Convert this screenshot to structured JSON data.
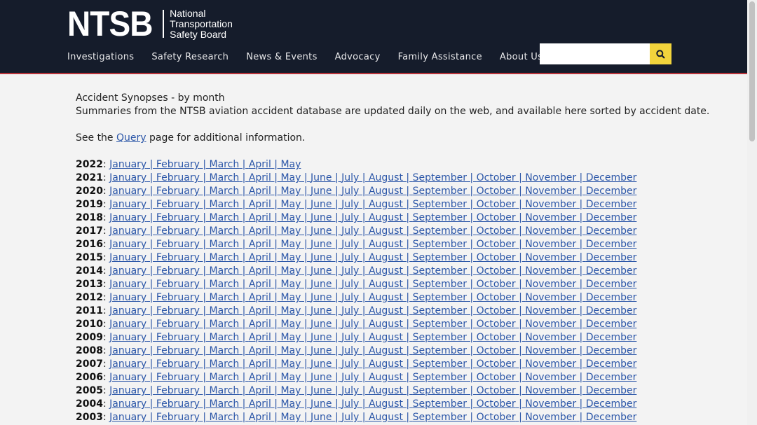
{
  "header": {
    "logo_mark": "NTSB",
    "logo_lines": [
      "National",
      "Transportation",
      "Safety Board"
    ],
    "nav": [
      "Investigations",
      "Safety Research",
      "News & Events",
      "Advocacy",
      "Family Assistance",
      "About Us"
    ],
    "search_placeholder": "",
    "search_icon": "search-icon"
  },
  "content": {
    "title": "Accident Synopses - by month",
    "description": "Summaries from the NTSB aviation accident database are updated daily on the web, and available here sorted by accident date.",
    "see_prefix": "See the ",
    "query_link": "Query",
    "see_suffix": " page for additional information.",
    "months": [
      "January",
      "February",
      "March",
      "April",
      "May",
      "June",
      "July",
      "August",
      "September",
      "October",
      "November",
      "December"
    ],
    "years": [
      {
        "year": "2022",
        "month_count": 5
      },
      {
        "year": "2021",
        "month_count": 12
      },
      {
        "year": "2020",
        "month_count": 12
      },
      {
        "year": "2019",
        "month_count": 12
      },
      {
        "year": "2018",
        "month_count": 12
      },
      {
        "year": "2017",
        "month_count": 12
      },
      {
        "year": "2016",
        "month_count": 12
      },
      {
        "year": "2015",
        "month_count": 12
      },
      {
        "year": "2014",
        "month_count": 12
      },
      {
        "year": "2013",
        "month_count": 12
      },
      {
        "year": "2012",
        "month_count": 12
      },
      {
        "year": "2011",
        "month_count": 12
      },
      {
        "year": "2010",
        "month_count": 12
      },
      {
        "year": "2009",
        "month_count": 12
      },
      {
        "year": "2008",
        "month_count": 12
      },
      {
        "year": "2007",
        "month_count": 12
      },
      {
        "year": "2006",
        "month_count": 12
      },
      {
        "year": "2005",
        "month_count": 12
      },
      {
        "year": "2004",
        "month_count": 12
      },
      {
        "year": "2003",
        "month_count": 12
      }
    ]
  }
}
